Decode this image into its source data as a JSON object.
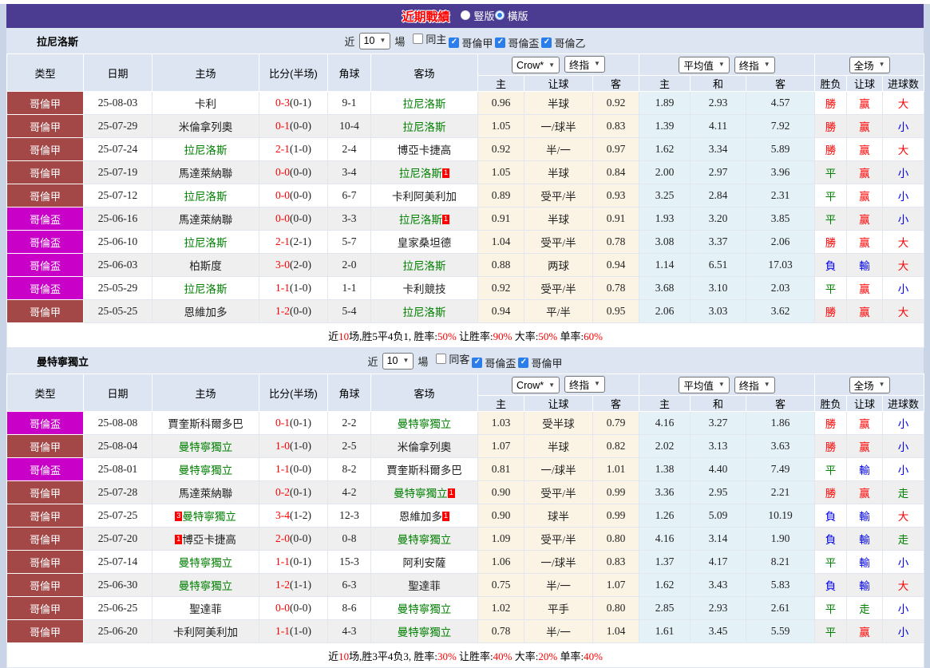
{
  "page": {
    "title": "近期戰績",
    "view_options": [
      {
        "label": "豎版",
        "selected": false
      },
      {
        "label": "橫版",
        "selected": true
      }
    ]
  },
  "colors": {
    "accent_purple": "#4b3c92",
    "title_red": "#ff0000",
    "league_primary_bg": "#a34747",
    "league_cup_bg": "#c800c8",
    "focus_team_green": "#008000",
    "win_red": "#ff0000",
    "draw_green": "#008000",
    "loss_blue": "#0000ee",
    "odds_col_cream": "#fbf3e3",
    "avg_col_blue": "#e4f1f7",
    "header_bg": "#dce5f1",
    "stripe_gray": "#efefef",
    "checkbox_blue": "#2b7de9"
  },
  "columns": {
    "type": "类型",
    "date": "日期",
    "home": "主场",
    "score": "比分(半场)",
    "corner": "角球",
    "away": "客场",
    "odds_home": "主",
    "odds_line": "让球",
    "odds_away": "客",
    "avg_home": "主",
    "avg_draw": "和",
    "avg_away": "客",
    "result": "胜负",
    "handicap": "让球",
    "goals": "进球数"
  },
  "tables": [
    {
      "team": "拉尼洛斯",
      "filter": {
        "near_label": "近",
        "count": "10",
        "games_label": "場",
        "same_label": "同主",
        "same_checked": false,
        "leagues": [
          {
            "label": "哥倫甲",
            "checked": true
          },
          {
            "label": "哥倫盃",
            "checked": true
          },
          {
            "label": "哥倫乙",
            "checked": true
          }
        ]
      },
      "selects": {
        "primary": "Crow*",
        "primary_final": "终指",
        "average": "平均值",
        "average_final": "终指",
        "scope": "全场"
      },
      "rows": [
        {
          "league": "哥倫甲",
          "league_kind": "primary",
          "date": "25-08-03",
          "home": "卡利",
          "home_is_team": false,
          "score": "0-3",
          "half": "(0-1)",
          "corner": "9-1",
          "away": "拉尼洛斯",
          "away_is_team": true,
          "crow_home": "0.96",
          "crow_line": "半球",
          "crow_away": "0.92",
          "avg_home": "1.89",
          "avg_draw": "2.93",
          "avg_away": "4.57",
          "result": "勝",
          "handicap_result": "赢",
          "goals_result": "大"
        },
        {
          "league": "哥倫甲",
          "league_kind": "primary",
          "date": "25-07-29",
          "home": "米倫拿列奧",
          "home_is_team": false,
          "score": "0-1",
          "half": "(0-0)",
          "corner": "10-4",
          "away": "拉尼洛斯",
          "away_is_team": true,
          "crow_home": "1.05",
          "crow_line": "一/球半",
          "crow_away": "0.83",
          "avg_home": "1.39",
          "avg_draw": "4.11",
          "avg_away": "7.92",
          "result": "勝",
          "handicap_result": "赢",
          "goals_result": "小"
        },
        {
          "league": "哥倫甲",
          "league_kind": "primary",
          "date": "25-07-24",
          "home": "拉尼洛斯",
          "home_is_team": true,
          "score": "2-1",
          "half": "(1-0)",
          "corner": "2-4",
          "away": "博亞卡捷高",
          "away_is_team": false,
          "crow_home": "0.92",
          "crow_line": "半/一",
          "crow_away": "0.97",
          "avg_home": "1.62",
          "avg_draw": "3.34",
          "avg_away": "5.89",
          "result": "勝",
          "handicap_result": "赢",
          "goals_result": "大"
        },
        {
          "league": "哥倫甲",
          "league_kind": "primary",
          "date": "25-07-19",
          "home": "馬達萊納聯",
          "home_is_team": false,
          "score": "0-0",
          "half": "(0-0)",
          "corner": "3-4",
          "away": "拉尼洛斯",
          "away_is_team": true,
          "away_badge": "1",
          "crow_home": "1.05",
          "crow_line": "半球",
          "crow_away": "0.84",
          "avg_home": "2.00",
          "avg_draw": "2.97",
          "avg_away": "3.96",
          "result": "平",
          "handicap_result": "赢",
          "goals_result": "小"
        },
        {
          "league": "哥倫甲",
          "league_kind": "primary",
          "date": "25-07-12",
          "home": "拉尼洛斯",
          "home_is_team": true,
          "score": "0-0",
          "half": "(0-0)",
          "corner": "6-7",
          "away": "卡利阿美利加",
          "away_is_team": false,
          "crow_home": "0.89",
          "crow_line": "受平/半",
          "crow_away": "0.93",
          "avg_home": "3.25",
          "avg_draw": "2.84",
          "avg_away": "2.31",
          "result": "平",
          "handicap_result": "赢",
          "goals_result": "小"
        },
        {
          "league": "哥倫盃",
          "league_kind": "cup",
          "date": "25-06-16",
          "home": "馬達萊納聯",
          "home_is_team": false,
          "score": "0-0",
          "half": "(0-0)",
          "corner": "3-3",
          "away": "拉尼洛斯",
          "away_is_team": true,
          "away_badge": "1",
          "crow_home": "0.91",
          "crow_line": "半球",
          "crow_away": "0.91",
          "avg_home": "1.93",
          "avg_draw": "3.20",
          "avg_away": "3.85",
          "result": "平",
          "handicap_result": "赢",
          "goals_result": "小"
        },
        {
          "league": "哥倫盃",
          "league_kind": "cup",
          "date": "25-06-10",
          "home": "拉尼洛斯",
          "home_is_team": true,
          "score": "2-1",
          "half": "(2-1)",
          "corner": "5-7",
          "away": "皇家桑坦德",
          "away_is_team": false,
          "crow_home": "1.04",
          "crow_line": "受平/半",
          "crow_away": "0.78",
          "avg_home": "3.08",
          "avg_draw": "3.37",
          "avg_away": "2.06",
          "result": "勝",
          "handicap_result": "赢",
          "goals_result": "大"
        },
        {
          "league": "哥倫盃",
          "league_kind": "cup",
          "date": "25-06-03",
          "home": "柏斯度",
          "home_is_team": false,
          "score": "3-0",
          "half": "(2-0)",
          "corner": "2-0",
          "away": "拉尼洛斯",
          "away_is_team": true,
          "crow_home": "0.88",
          "crow_line": "两球",
          "crow_away": "0.94",
          "avg_home": "1.14",
          "avg_draw": "6.51",
          "avg_away": "17.03",
          "result": "負",
          "handicap_result": "輸",
          "goals_result": "大"
        },
        {
          "league": "哥倫盃",
          "league_kind": "cup",
          "date": "25-05-29",
          "home": "拉尼洛斯",
          "home_is_team": true,
          "score": "1-1",
          "half": "(1-0)",
          "corner": "1-1",
          "away": "卡利競技",
          "away_is_team": false,
          "crow_home": "0.92",
          "crow_line": "受平/半",
          "crow_away": "0.78",
          "avg_home": "3.68",
          "avg_draw": "3.10",
          "avg_away": "2.03",
          "result": "平",
          "handicap_result": "赢",
          "goals_result": "小"
        },
        {
          "league": "哥倫甲",
          "league_kind": "primary",
          "date": "25-05-25",
          "home": "恩維加多",
          "home_is_team": false,
          "score": "1-2",
          "half": "(0-0)",
          "corner": "5-4",
          "away": "拉尼洛斯",
          "away_is_team": true,
          "crow_home": "0.94",
          "crow_line": "平/半",
          "crow_away": "0.95",
          "avg_home": "2.06",
          "avg_draw": "3.03",
          "avg_away": "3.62",
          "result": "勝",
          "handicap_result": "赢",
          "goals_result": "大"
        }
      ],
      "summary": [
        {
          "text": "近",
          "red": false
        },
        {
          "text": "10",
          "red": true
        },
        {
          "text": "场,胜5平4负1, 胜率:",
          "red": false
        },
        {
          "text": "50%",
          "red": true
        },
        {
          "text": " 让胜率:",
          "red": false
        },
        {
          "text": "90%",
          "red": true
        },
        {
          "text": " 大率:",
          "red": false
        },
        {
          "text": "50%",
          "red": true
        },
        {
          "text": " 单率:",
          "red": false
        },
        {
          "text": "60%",
          "red": true
        }
      ]
    },
    {
      "team": "曼特寧獨立",
      "filter": {
        "near_label": "近",
        "count": "10",
        "games_label": "場",
        "same_label": "同客",
        "same_checked": false,
        "leagues": [
          {
            "label": "哥倫盃",
            "checked": true
          },
          {
            "label": "哥倫甲",
            "checked": true
          }
        ]
      },
      "selects": {
        "primary": "Crow*",
        "primary_final": "终指",
        "average": "平均值",
        "average_final": "终指",
        "scope": "全场"
      },
      "rows": [
        {
          "league": "哥倫盃",
          "league_kind": "cup",
          "date": "25-08-08",
          "home": "賈奎斯科爾多巴",
          "home_is_team": false,
          "score": "0-1",
          "half": "(0-1)",
          "corner": "2-2",
          "away": "曼特寧獨立",
          "away_is_team": true,
          "crow_home": "1.03",
          "crow_line": "受半球",
          "crow_away": "0.79",
          "avg_home": "4.16",
          "avg_draw": "3.27",
          "avg_away": "1.86",
          "result": "勝",
          "handicap_result": "赢",
          "goals_result": "小"
        },
        {
          "league": "哥倫甲",
          "league_kind": "primary",
          "date": "25-08-04",
          "home": "曼特寧獨立",
          "home_is_team": true,
          "score": "1-0",
          "half": "(1-0)",
          "corner": "2-5",
          "away": "米倫拿列奧",
          "away_is_team": false,
          "crow_home": "1.07",
          "crow_line": "半球",
          "crow_away": "0.82",
          "avg_home": "2.02",
          "avg_draw": "3.13",
          "avg_away": "3.63",
          "result": "勝",
          "handicap_result": "赢",
          "goals_result": "小"
        },
        {
          "league": "哥倫盃",
          "league_kind": "cup",
          "date": "25-08-01",
          "home": "曼特寧獨立",
          "home_is_team": true,
          "score": "1-1",
          "half": "(0-0)",
          "corner": "8-2",
          "away": "賈奎斯科爾多巴",
          "away_is_team": false,
          "crow_home": "0.81",
          "crow_line": "一/球半",
          "crow_away": "1.01",
          "avg_home": "1.38",
          "avg_draw": "4.40",
          "avg_away": "7.49",
          "result": "平",
          "handicap_result": "輸",
          "goals_result": "小"
        },
        {
          "league": "哥倫甲",
          "league_kind": "primary",
          "date": "25-07-28",
          "home": "馬達萊納聯",
          "home_is_team": false,
          "score": "0-2",
          "half": "(0-1)",
          "corner": "4-2",
          "away": "曼特寧獨立",
          "away_is_team": true,
          "away_badge": "1",
          "crow_home": "0.90",
          "crow_line": "受平/半",
          "crow_away": "0.99",
          "avg_home": "3.36",
          "avg_draw": "2.95",
          "avg_away": "2.21",
          "result": "勝",
          "handicap_result": "赢",
          "goals_result": "走"
        },
        {
          "league": "哥倫甲",
          "league_kind": "primary",
          "date": "25-07-25",
          "home": "曼特寧獨立",
          "home_is_team": true,
          "home_badge": "3",
          "score": "3-4",
          "half": "(1-2)",
          "corner": "12-3",
          "away": "恩維加多",
          "away_is_team": false,
          "away_badge": "1",
          "crow_home": "0.90",
          "crow_line": "球半",
          "crow_away": "0.99",
          "avg_home": "1.26",
          "avg_draw": "5.09",
          "avg_away": "10.19",
          "result": "負",
          "handicap_result": "輸",
          "goals_result": "大"
        },
        {
          "league": "哥倫甲",
          "league_kind": "primary",
          "date": "25-07-20",
          "home": "博亞卡捷高",
          "home_is_team": false,
          "home_badge": "1",
          "score": "2-0",
          "half": "(0-0)",
          "corner": "0-8",
          "away": "曼特寧獨立",
          "away_is_team": true,
          "crow_home": "1.09",
          "crow_line": "受平/半",
          "crow_away": "0.80",
          "avg_home": "4.16",
          "avg_draw": "3.14",
          "avg_away": "1.90",
          "result": "負",
          "handicap_result": "輸",
          "goals_result": "走"
        },
        {
          "league": "哥倫甲",
          "league_kind": "primary",
          "date": "25-07-14",
          "home": "曼特寧獨立",
          "home_is_team": true,
          "score": "1-1",
          "half": "(0-1)",
          "corner": "15-3",
          "away": "阿利安薩",
          "away_is_team": false,
          "crow_home": "1.06",
          "crow_line": "一/球半",
          "crow_away": "0.83",
          "avg_home": "1.37",
          "avg_draw": "4.17",
          "avg_away": "8.21",
          "result": "平",
          "handicap_result": "輸",
          "goals_result": "小"
        },
        {
          "league": "哥倫甲",
          "league_kind": "primary",
          "date": "25-06-30",
          "home": "曼特寧獨立",
          "home_is_team": true,
          "score": "1-2",
          "half": "(1-1)",
          "corner": "6-3",
          "away": "聖達菲",
          "away_is_team": false,
          "crow_home": "0.75",
          "crow_line": "半/一",
          "crow_away": "1.07",
          "avg_home": "1.62",
          "avg_draw": "3.43",
          "avg_away": "5.83",
          "result": "負",
          "handicap_result": "輸",
          "goals_result": "大"
        },
        {
          "league": "哥倫甲",
          "league_kind": "primary",
          "date": "25-06-25",
          "home": "聖達菲",
          "home_is_team": false,
          "score": "0-0",
          "half": "(0-0)",
          "corner": "8-6",
          "away": "曼特寧獨立",
          "away_is_team": true,
          "crow_home": "1.02",
          "crow_line": "平手",
          "crow_away": "0.80",
          "avg_home": "2.85",
          "avg_draw": "2.93",
          "avg_away": "2.61",
          "result": "平",
          "handicap_result": "走",
          "goals_result": "小"
        },
        {
          "league": "哥倫甲",
          "league_kind": "primary",
          "date": "25-06-20",
          "home": "卡利阿美利加",
          "home_is_team": false,
          "score": "1-1",
          "half": "(1-0)",
          "corner": "4-3",
          "away": "曼特寧獨立",
          "away_is_team": true,
          "crow_home": "0.78",
          "crow_line": "半/一",
          "crow_away": "1.04",
          "avg_home": "1.61",
          "avg_draw": "3.45",
          "avg_away": "5.59",
          "result": "平",
          "handicap_result": "赢",
          "goals_result": "小"
        }
      ],
      "summary": [
        {
          "text": "近",
          "red": false
        },
        {
          "text": "10",
          "red": true
        },
        {
          "text": "场,胜3平4负3, 胜率:",
          "red": false
        },
        {
          "text": "30%",
          "red": true
        },
        {
          "text": " 让胜率:",
          "red": false
        },
        {
          "text": "40%",
          "red": true
        },
        {
          "text": " 大率:",
          "red": false
        },
        {
          "text": "20%",
          "red": true
        },
        {
          "text": " 单率:",
          "red": false
        },
        {
          "text": "40%",
          "red": true
        }
      ]
    }
  ]
}
